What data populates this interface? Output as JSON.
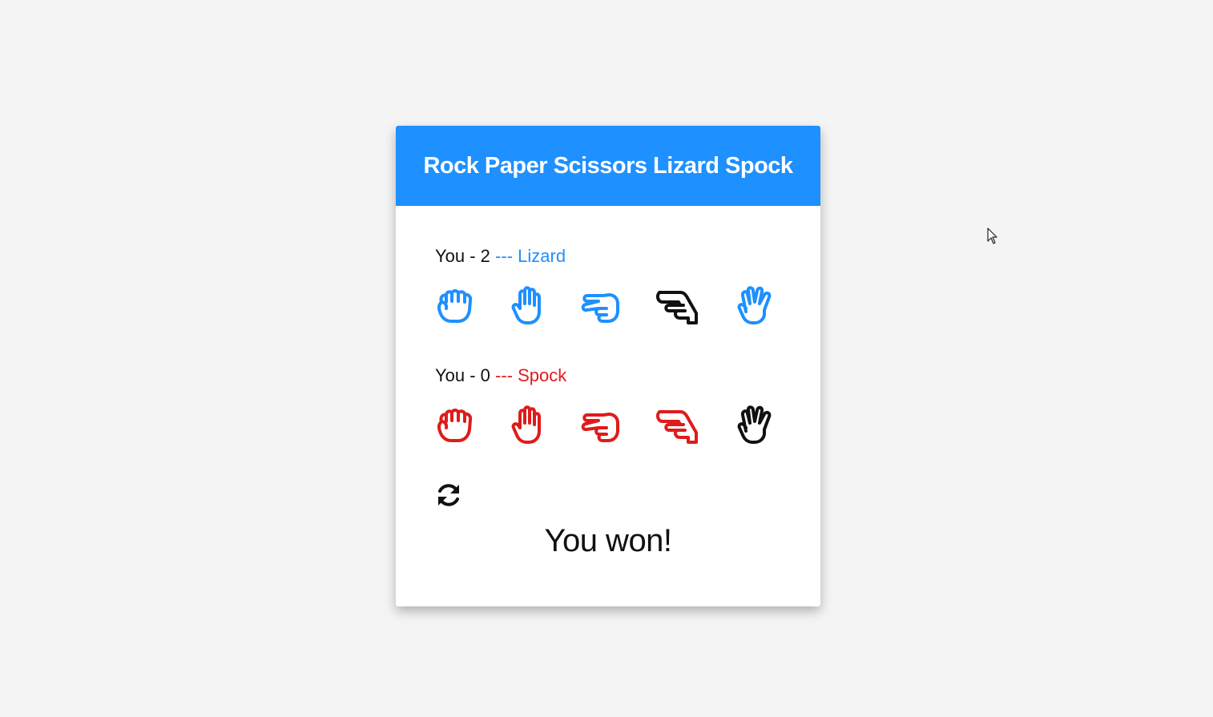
{
  "app": {
    "title": "Rock Paper Scissors Lizard Spock"
  },
  "colors": {
    "header_bg": "#1e90ff",
    "player1": "#1e90ff",
    "player2": "#e01b1b",
    "selected": "#111111",
    "page_bg": "#f4f4f4"
  },
  "player1": {
    "score_text": "You - 2",
    "choice_text": "--- Lizard",
    "hands": [
      {
        "name": "Rock",
        "icon": "hand-rock-icon",
        "selected": false
      },
      {
        "name": "Paper",
        "icon": "hand-paper-icon",
        "selected": false
      },
      {
        "name": "Scissors",
        "icon": "hand-scissors-icon",
        "selected": false
      },
      {
        "name": "Lizard",
        "icon": "hand-lizard-icon",
        "selected": true
      },
      {
        "name": "Spock",
        "icon": "hand-spock-icon",
        "selected": false
      }
    ]
  },
  "player2": {
    "score_text": "You - 0",
    "choice_text": "--- Spock",
    "hands": [
      {
        "name": "Rock",
        "icon": "hand-rock-icon",
        "selected": false
      },
      {
        "name": "Paper",
        "icon": "hand-paper-icon",
        "selected": false
      },
      {
        "name": "Scissors",
        "icon": "hand-scissors-icon",
        "selected": false
      },
      {
        "name": "Lizard",
        "icon": "hand-lizard-icon",
        "selected": false
      },
      {
        "name": "Spock",
        "icon": "hand-spock-icon",
        "selected": true
      }
    ]
  },
  "controls": {
    "reset_icon": "refresh-icon"
  },
  "result": {
    "text": "You won!"
  }
}
